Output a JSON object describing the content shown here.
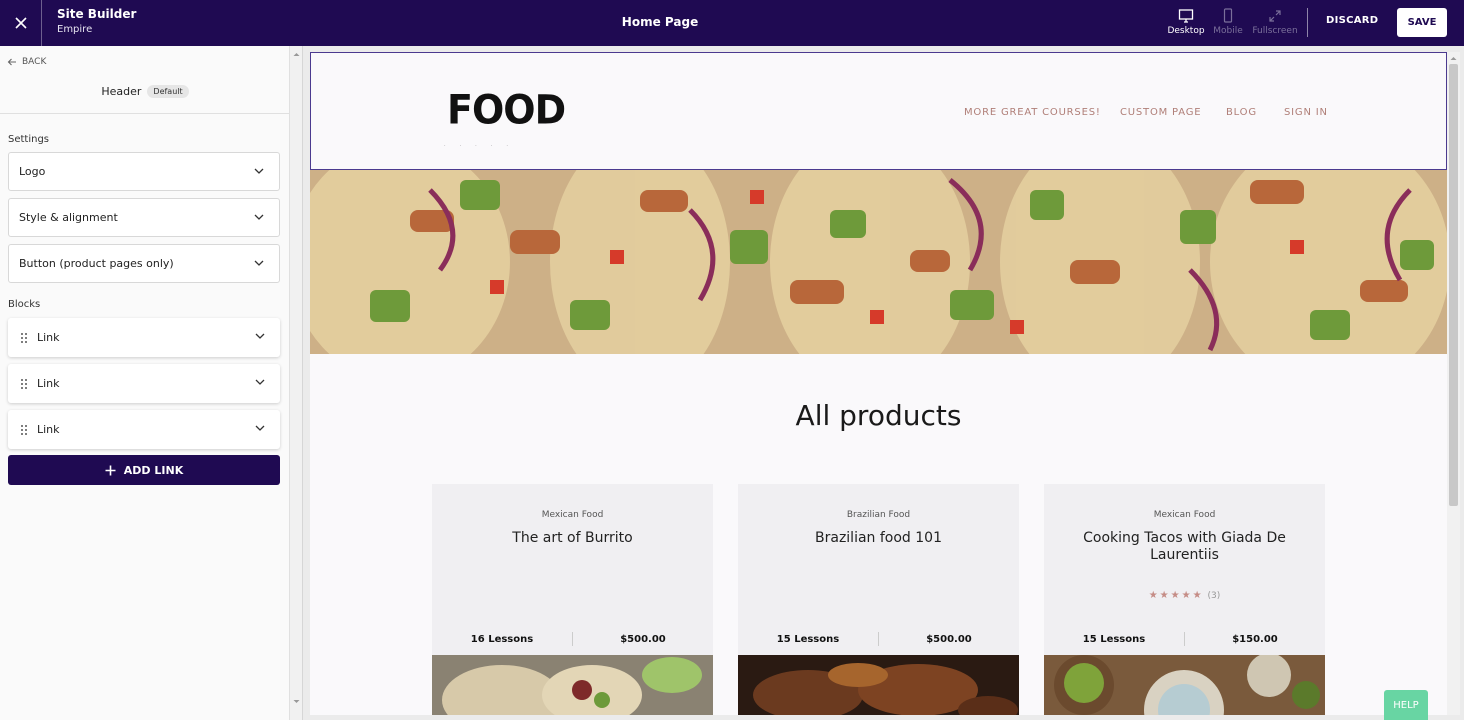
{
  "topbar": {
    "app_title": "Site Builder",
    "app_subtitle": "Empire",
    "page_title": "Home Page",
    "views": [
      {
        "label": "Desktop",
        "icon": "desktop-icon",
        "active": true
      },
      {
        "label": "Mobile",
        "icon": "mobile-icon",
        "active": false
      },
      {
        "label": "Fullscreen",
        "icon": "fullscreen-icon",
        "active": false
      }
    ],
    "discard_label": "DISCARD",
    "save_label": "SAVE"
  },
  "sidebar": {
    "back_label": "BACK",
    "section_title": "Header",
    "section_badge": "Default",
    "settings_label": "Settings",
    "settings": [
      {
        "label": "Logo"
      },
      {
        "label": "Style & alignment"
      },
      {
        "label": "Button (product pages only)"
      }
    ],
    "blocks_label": "Blocks",
    "blocks": [
      {
        "label": "Link"
      },
      {
        "label": "Link"
      },
      {
        "label": "Link"
      }
    ],
    "add_link_label": "ADD LINK"
  },
  "preview": {
    "logo_text": "FOOD",
    "nav": [
      "MORE GREAT COURSES!",
      "CUSTOM PAGE",
      "BLOG",
      "SIGN IN"
    ],
    "section_title": "All products",
    "products": [
      {
        "category": "Mexican Food",
        "title": "The art of Burrito",
        "stars": "",
        "rating_count": "",
        "lessons": "16 Lessons",
        "price": "$500.00"
      },
      {
        "category": "Brazilian Food",
        "title": "Brazilian food 101",
        "stars": "",
        "rating_count": "",
        "lessons": "15 Lessons",
        "price": "$500.00"
      },
      {
        "category": "Mexican Food",
        "title": "Cooking Tacos with Giada De Laurentiis",
        "stars": "★★★★★",
        "rating_count": "(3)",
        "lessons": "15 Lessons",
        "price": "$150.00"
      }
    ]
  },
  "help_label": "HELP",
  "colors": {
    "brand": "#1f0a52",
    "nav_text": "#b07f78",
    "help": "#68d5a3"
  }
}
